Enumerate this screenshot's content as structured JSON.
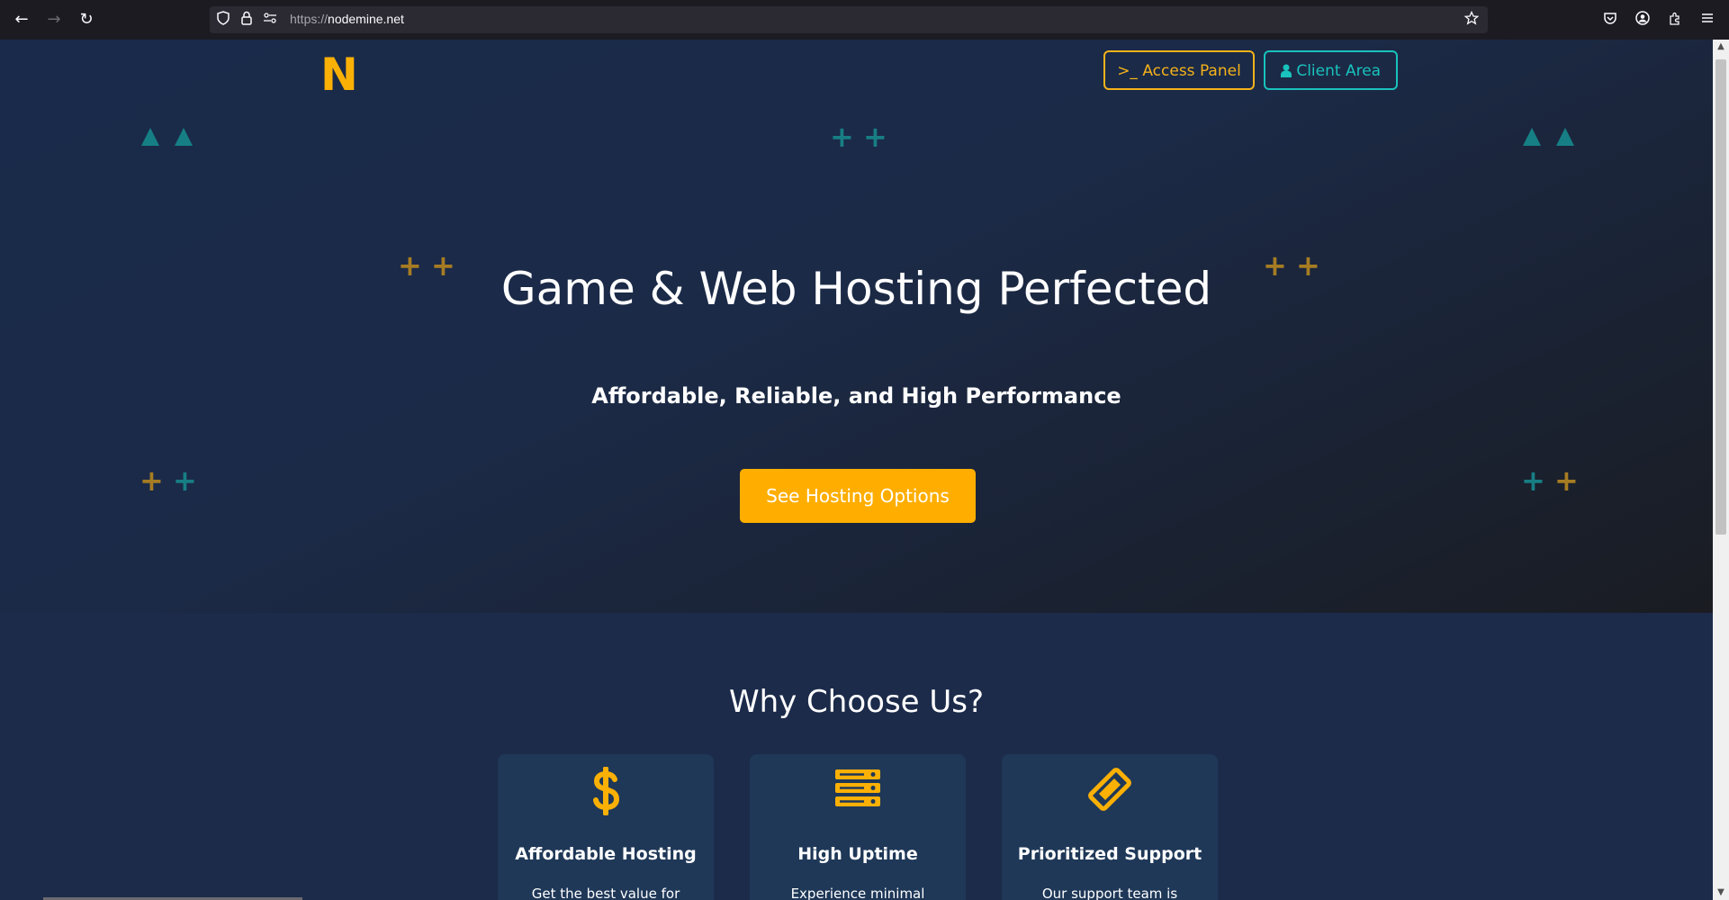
{
  "browser": {
    "url_scheme": "https://",
    "url_host": "nodemine.net",
    "icons": [
      "back-arrow-icon",
      "forward-arrow-icon",
      "reload-icon",
      "shield-icon",
      "lock-icon",
      "permissions-icon",
      "bookmark-star-icon",
      "pocket-icon",
      "account-icon",
      "extensions-icon",
      "menu-icon"
    ]
  },
  "header": {
    "logo": "N",
    "access_panel": {
      "prompt": ">_",
      "label": "Access Panel"
    },
    "client_area": {
      "label": "Client Area"
    }
  },
  "hero": {
    "title": "Game & Web Hosting Perfected",
    "subtitle": "Affordable, Reliable, and High Performance",
    "cta": "See Hosting Options"
  },
  "why": {
    "title": "Why Choose Us?",
    "cards": [
      {
        "icon": "dollar-icon",
        "title": "Affordable Hosting",
        "text": "Get the best value for"
      },
      {
        "icon": "server-icon",
        "title": "High Uptime",
        "text": "Experience minimal"
      },
      {
        "icon": "ticket-icon",
        "title": "Prioritized Support",
        "text": "Our support team is"
      }
    ]
  },
  "colors": {
    "accent_gold": "#fab005",
    "accent_teal": "#19c2bd",
    "hero_bg": "#1a2a4a",
    "card_bg": "#1f3858"
  }
}
